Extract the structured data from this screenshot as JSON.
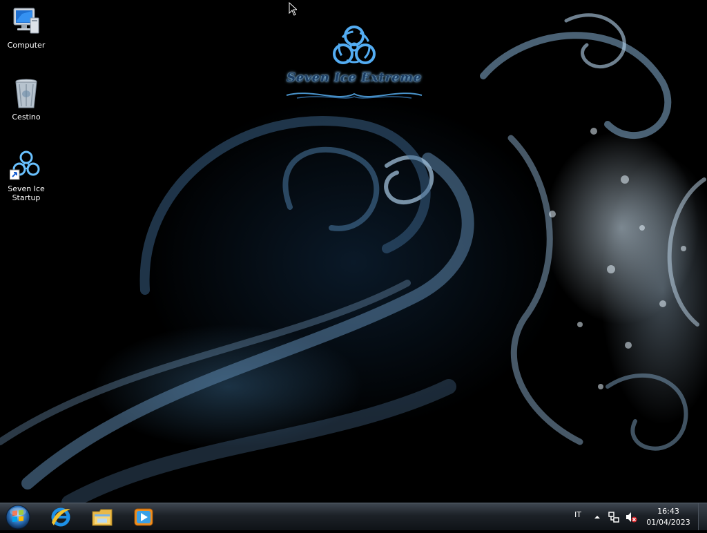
{
  "desktop": {
    "icons": [
      {
        "label": "Computer",
        "icon": "computer-icon"
      },
      {
        "label": "Cestino",
        "icon": "recycle-bin-icon"
      },
      {
        "label": "Seven Ice\nStartup",
        "icon": "biohazard-shortcut-icon"
      }
    ],
    "logo_text": "Seven Ice Extreme"
  },
  "taskbar": {
    "start_icon": "windows-start-orb",
    "pinned": [
      {
        "name": "Internet Explorer",
        "icon": "internet-explorer-icon"
      },
      {
        "name": "Esplora risorse",
        "icon": "file-explorer-icon"
      },
      {
        "name": "Windows Media Player",
        "icon": "media-player-icon"
      }
    ],
    "tray": {
      "language": "IT",
      "chevron_icon": "show-hidden-icons-chevron",
      "network_icon": "network-icon",
      "volume_icon": "volume-muted-icon",
      "time": "16:43",
      "date": "01/04/2023"
    }
  },
  "colors": {
    "accent": "#7ec6ff",
    "taskbar_top": "#3e4650",
    "taskbar_bottom": "#0f1317"
  }
}
